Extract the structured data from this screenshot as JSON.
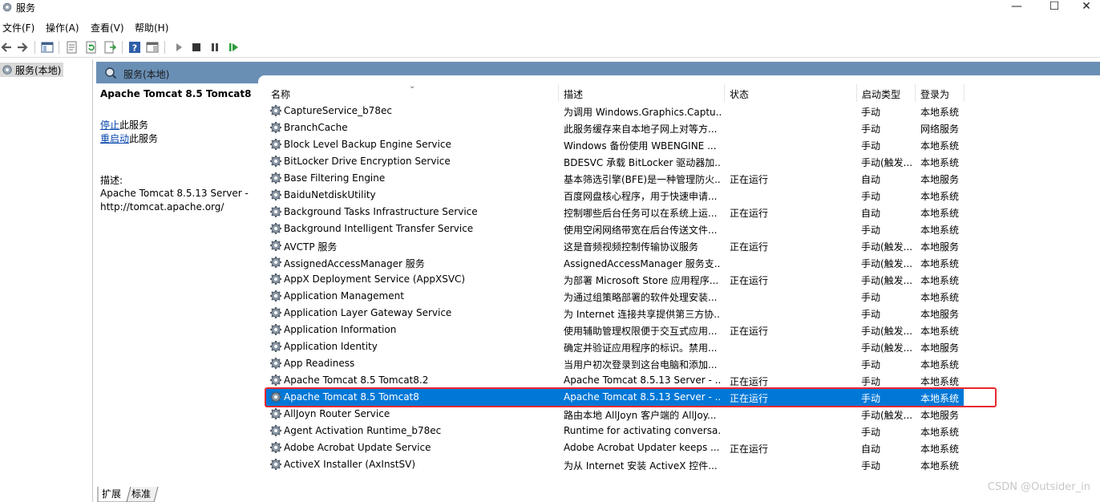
{
  "window": {
    "title": "服务",
    "minimize": "—",
    "maximize": "☐",
    "close": "✕"
  },
  "menu": [
    "文件(F)",
    "操作(A)",
    "查看(V)",
    "帮助(H)"
  ],
  "tree": {
    "node_label": "服务(本地)"
  },
  "pane": {
    "header_title": "服务(本地)"
  },
  "details": {
    "service_name": "Apache Tomcat 8.5 Tomcat8",
    "stop_link": "停止",
    "stop_suffix": "此服务",
    "restart_link": "重启动",
    "restart_suffix": "此服务",
    "desc_label": "描述:",
    "desc_text": "Apache Tomcat 8.5.13 Server - http://tomcat.apache.org/"
  },
  "columns": {
    "name": "名称",
    "desc": "描述",
    "status": "状态",
    "startup": "启动类型",
    "logon": "登录为"
  },
  "services": [
    {
      "name": "CaptureService_b78ec",
      "desc": "为调用 Windows.Graphics.Captu...",
      "status": "",
      "startup": "手动",
      "logon": "本地系统"
    },
    {
      "name": "BranchCache",
      "desc": "此服务缓存来自本地子网上对等方...",
      "status": "",
      "startup": "手动",
      "logon": "网络服务"
    },
    {
      "name": "Block Level Backup Engine Service",
      "desc": "Windows 备份使用 WBENGINE ...",
      "status": "",
      "startup": "手动",
      "logon": "本地系统"
    },
    {
      "name": "BitLocker Drive Encryption Service",
      "desc": "BDESVC 承载 BitLocker 驱动器加...",
      "status": "",
      "startup": "手动(触发...",
      "logon": "本地系统"
    },
    {
      "name": "Base Filtering Engine",
      "desc": "基本筛选引擎(BFE)是一种管理防火...",
      "status": "正在运行",
      "startup": "自动",
      "logon": "本地服务"
    },
    {
      "name": "BaiduNetdiskUtility",
      "desc": "百度网盘核心程序，用于快速申请...",
      "status": "",
      "startup": "手动",
      "logon": "本地系统"
    },
    {
      "name": "Background Tasks Infrastructure Service",
      "desc": "控制哪些后台任务可以在系统上运...",
      "status": "正在运行",
      "startup": "自动",
      "logon": "本地系统"
    },
    {
      "name": "Background Intelligent Transfer Service",
      "desc": "使用空闲网络带宽在后台传送文件...",
      "status": "",
      "startup": "手动",
      "logon": "本地系统"
    },
    {
      "name": "AVCTP 服务",
      "desc": "这是音频视频控制传输协议服务",
      "status": "正在运行",
      "startup": "手动(触发...",
      "logon": "本地服务"
    },
    {
      "name": "AssignedAccessManager 服务",
      "desc": "AssignedAccessManager 服务支...",
      "status": "",
      "startup": "手动(触发...",
      "logon": "本地系统"
    },
    {
      "name": "AppX Deployment Service (AppXSVC)",
      "desc": "为部署 Microsoft Store 应用程序...",
      "status": "正在运行",
      "startup": "手动(触发...",
      "logon": "本地系统"
    },
    {
      "name": "Application Management",
      "desc": "为通过组策略部署的软件处理安装...",
      "status": "",
      "startup": "手动",
      "logon": "本地系统"
    },
    {
      "name": "Application Layer Gateway Service",
      "desc": "为 Internet 连接共享提供第三方协...",
      "status": "",
      "startup": "手动",
      "logon": "本地服务"
    },
    {
      "name": "Application Information",
      "desc": "使用辅助管理权限便于交互式应用...",
      "status": "正在运行",
      "startup": "手动(触发...",
      "logon": "本地系统"
    },
    {
      "name": "Application Identity",
      "desc": "确定并验证应用程序的标识。禁用...",
      "status": "",
      "startup": "手动(触发...",
      "logon": "本地服务"
    },
    {
      "name": "App Readiness",
      "desc": "当用户初次登录到这台电脑和添加...",
      "status": "",
      "startup": "手动",
      "logon": "本地系统"
    },
    {
      "name": "Apache Tomcat 8.5 Tomcat8.2",
      "desc": "Apache Tomcat 8.5.13 Server - ...",
      "status": "正在运行",
      "startup": "手动",
      "logon": "本地系统"
    },
    {
      "name": "Apache Tomcat 8.5 Tomcat8",
      "desc": "Apache Tomcat 8.5.13 Server - ...",
      "status": "正在运行",
      "startup": "手动",
      "logon": "本地系统",
      "selected": true
    },
    {
      "name": "AllJoyn Router Service",
      "desc": "路由本地 AllJoyn 客户端的 AllJoy...",
      "status": "",
      "startup": "手动(触发...",
      "logon": "本地服务"
    },
    {
      "name": "Agent Activation Runtime_b78ec",
      "desc": "Runtime for activating conversa...",
      "status": "",
      "startup": "手动",
      "logon": "本地系统"
    },
    {
      "name": "Adobe Acrobat Update Service",
      "desc": "Adobe Acrobat Updater keeps ...",
      "status": "正在运行",
      "startup": "自动",
      "logon": "本地系统"
    },
    {
      "name": "ActiveX Installer (AxInstSV)",
      "desc": "为从 Internet 安装 ActiveX 控件...",
      "status": "",
      "startup": "手动",
      "logon": "本地系统"
    }
  ],
  "tabs": [
    "扩展",
    "标准"
  ],
  "watermark": "CSDN @Outsider_in",
  "colors": {
    "selection": "#0078d7",
    "highlight_box": "#e8282f",
    "pane_header": "#6a8fb5"
  }
}
